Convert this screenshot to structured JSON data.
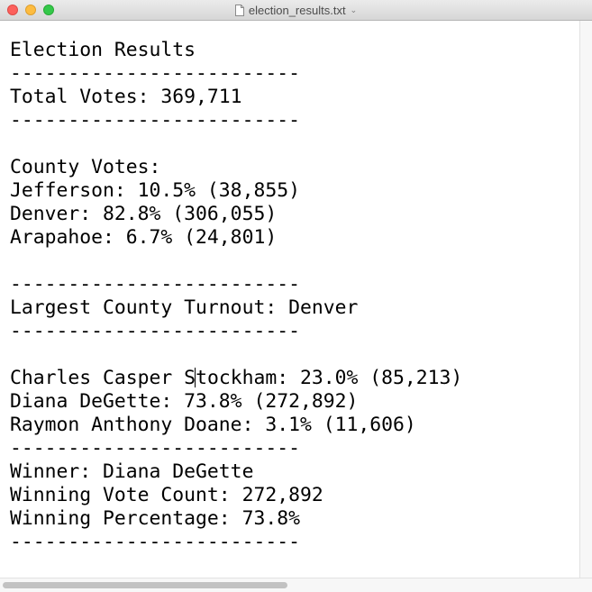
{
  "window": {
    "title": "election_results.txt",
    "icons": {
      "document": "document-icon",
      "chevron": "chevron-down-icon"
    }
  },
  "document": {
    "lines": [
      "Election Results",
      "-------------------------",
      "Total Votes: 369,711",
      "-------------------------",
      "",
      "County Votes:",
      "Jefferson: 10.5% (38,855)",
      "Denver: 82.8% (306,055)",
      "Arapahoe: 6.7% (24,801)",
      "",
      "-------------------------",
      "Largest County Turnout: Denver",
      "-------------------------",
      "",
      "Charles Casper Stockham: 23.0% (85,213)",
      "Diana DeGette: 73.8% (272,892)",
      "Raymon Anthony Doane: 3.1% (11,606)",
      "-------------------------",
      "Winner: Diana DeGette",
      "Winning Vote Count: 272,892",
      "Winning Percentage: 73.8%",
      "-------------------------"
    ],
    "cursor": {
      "line_index": 14,
      "before": "Charles Casper S",
      "after": "tockham: 23.0% (85,213)"
    }
  }
}
